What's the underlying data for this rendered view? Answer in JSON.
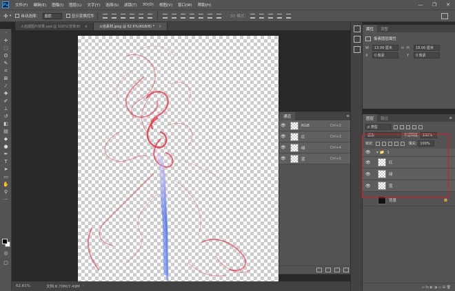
{
  "app": {
    "logo": "Ps"
  },
  "menu": [
    "文件(F)",
    "编辑(E)",
    "图像(I)",
    "图层(L)",
    "文字(Y)",
    "选择(S)",
    "滤镜(T)",
    "3D(D)",
    "视图(V)",
    "窗口(W)",
    "帮助(H)"
  ],
  "window_controls": {
    "minimize": "—",
    "restore": "❐",
    "close": "✕"
  },
  "options": {
    "auto_select_label": "自动选择：",
    "auto_select_value": "图层",
    "show_transform_label": "显示变换控件",
    "mode_3d": "3D 模式："
  },
  "tabs": [
    {
      "label": "火焰烟图片效果.psd @ 100%(背景/8)",
      "close": "×",
      "active": false
    },
    {
      "label": "火焰素材.jpeg @ 62.6%(RGB/8) *",
      "close": "×",
      "active": true
    }
  ],
  "status": {
    "zoom": "62.61%",
    "doc_size": "文档:6.70M/7.49M",
    "arrow": "›"
  },
  "channels": {
    "tab": "通道",
    "menu_icon": "≡",
    "rows": [
      {
        "name": "RGB",
        "shortcut": "Ctrl+2",
        "eye": "👁"
      },
      {
        "name": "红",
        "shortcut": "Ctrl+3",
        "eye": "👁"
      },
      {
        "name": "绿",
        "shortcut": "Ctrl+4",
        "eye": "👁"
      },
      {
        "name": "蓝",
        "shortcut": "Ctrl+5",
        "eye": "👁"
      }
    ]
  },
  "properties": {
    "tab_active": "属性",
    "tab_other": "调整",
    "layer_type": "像素图层属性",
    "w_label": "W",
    "w_value": "13.99 厘米",
    "h_label": "H",
    "h_value": "18.06 厘米",
    "x_label": "X",
    "x_value": "0 像素",
    "y_label": "Y",
    "y_value": "0 像素",
    "link": "⊖"
  },
  "layers": {
    "tab_active": "图层",
    "tab_other": "路径",
    "menu_icon": "≡",
    "kind_label": "ρ 类型",
    "blend_mode": "滤色",
    "opacity_label": "不透明度:",
    "opacity_value": "100%",
    "lock_label": "锁定:",
    "fill_label": "填充:",
    "fill_value": "100%",
    "group": {
      "name": "1",
      "eye": "👁",
      "arrow": "▾ 📁"
    },
    "rows": [
      {
        "name": "红",
        "eye": "👁"
      },
      {
        "name": "绿",
        "eye": "👁"
      },
      {
        "name": "蓝",
        "eye": "👁"
      }
    ],
    "background": {
      "name": "背景",
      "lock": "🔒"
    },
    "bottom_icons": "∞ fx ◐ ◑ ▭ ⊞ 🗑"
  },
  "colors": {
    "highlight": "#e6141e",
    "smoke_red": "#e8283c",
    "smoke_blue": "#5a7de6"
  }
}
